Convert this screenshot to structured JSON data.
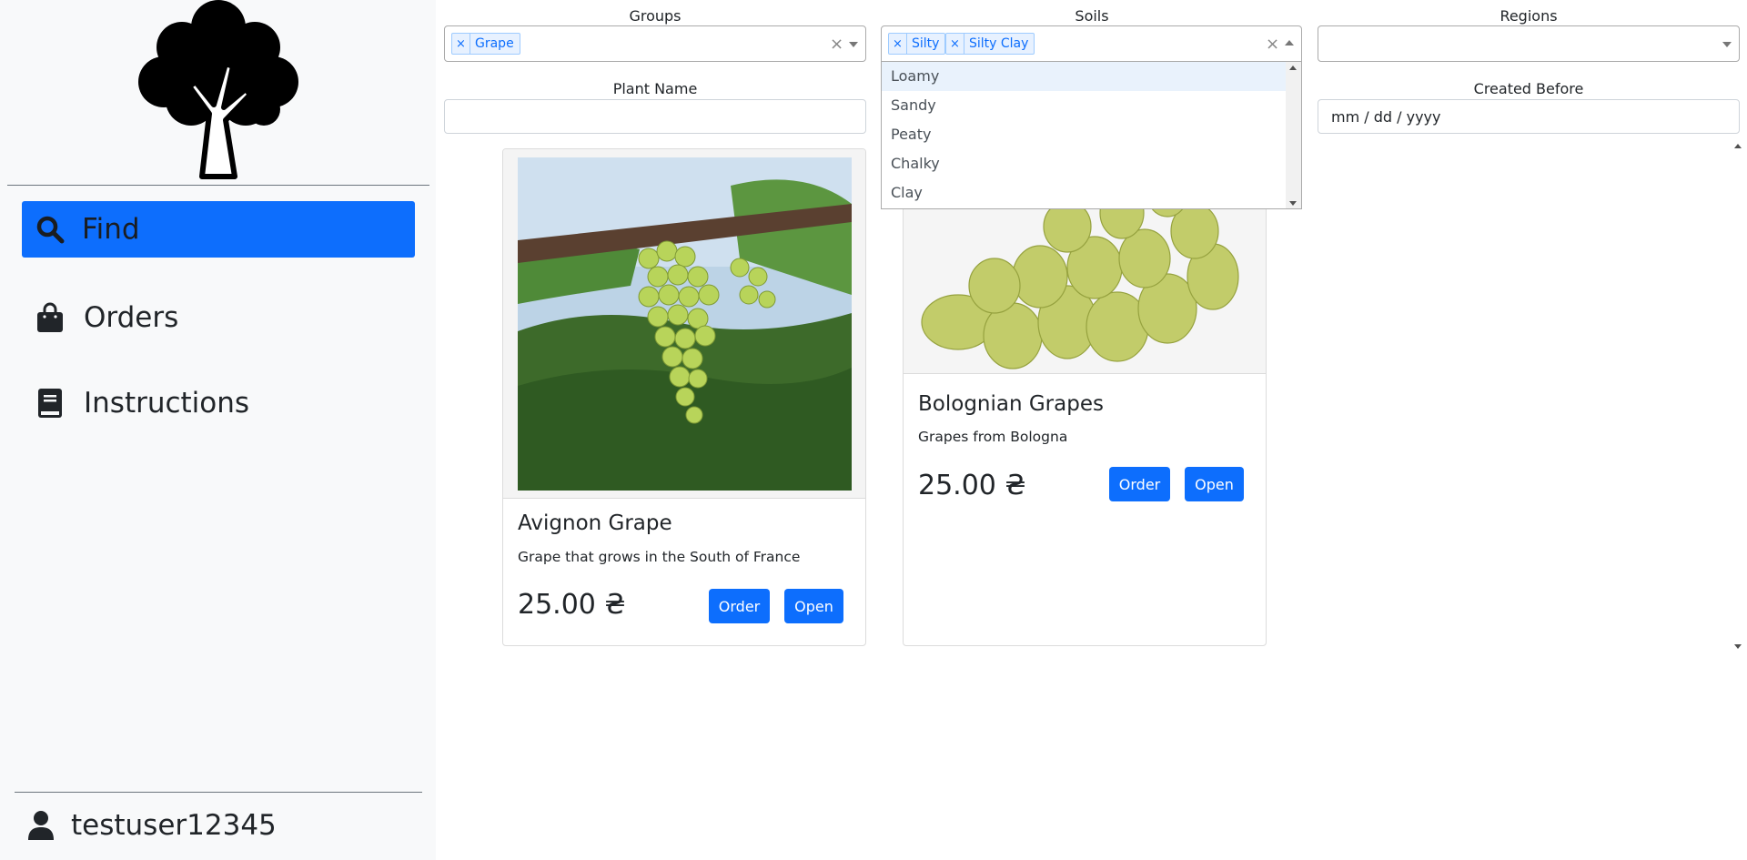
{
  "sidebar": {
    "logo_icon": "tree-icon",
    "items": [
      {
        "label": "Find",
        "icon": "search-icon",
        "active": true
      },
      {
        "label": "Orders",
        "icon": "shopping-bag-icon",
        "active": false
      },
      {
        "label": "Instructions",
        "icon": "book-icon",
        "active": false
      }
    ],
    "user": {
      "name": "testuser12345",
      "icon": "user-icon"
    }
  },
  "filters": {
    "groups": {
      "label": "Groups",
      "selected": [
        "Grape"
      ]
    },
    "soils": {
      "label": "Soils",
      "selected": [
        "Silty",
        "Silty Clay"
      ],
      "options": [
        "Loamy",
        "Sandy",
        "Peaty",
        "Chalky",
        "Clay"
      ],
      "highlighted": "Loamy"
    },
    "regions": {
      "label": "Regions",
      "selected": []
    },
    "plant_name": {
      "label": "Plant Name",
      "value": ""
    },
    "created_before": {
      "label": "Created Before",
      "placeholder": "mm / dd / yyyy"
    }
  },
  "clear_symbol": "×",
  "products": [
    {
      "name": "Avignon Grape",
      "description": "Grape that grows in the South of France",
      "price": "25.00 ₴",
      "order_label": "Order",
      "open_label": "Open"
    },
    {
      "name": "Bolognian Grapes",
      "description": "Grapes from Bologna",
      "price": "25.00 ₴",
      "order_label": "Order",
      "open_label": "Open"
    }
  ],
  "colors": {
    "primary": "#0d6efd",
    "sidebar_bg": "#f8f9fa",
    "tag_bg": "#e7f1ff",
    "highlight": "#e9f2fc"
  }
}
